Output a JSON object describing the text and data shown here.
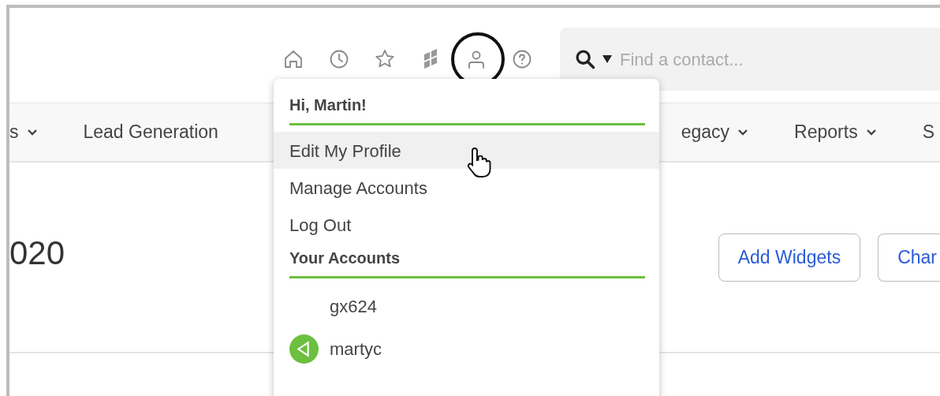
{
  "header": {
    "icons": [
      {
        "kind": "home"
      },
      {
        "kind": "clock"
      },
      {
        "kind": "star"
      },
      {
        "kind": "grid"
      },
      {
        "kind": "user",
        "highlighted": true
      },
      {
        "kind": "help"
      }
    ],
    "search": {
      "placeholder": "Find a contact..."
    }
  },
  "nav": [
    {
      "label": "s",
      "dropdown": true
    },
    {
      "label": "Lead Generation",
      "dropdown": false
    },
    {
      "label": "egacy",
      "dropdown": true
    },
    {
      "label": "Reports",
      "dropdown": true
    },
    {
      "label": "S",
      "dropdown": false
    }
  ],
  "page": {
    "heading": "020",
    "buttons": [
      "Add Widgets",
      "Char"
    ]
  },
  "user_menu": {
    "greeting": "Hi, Martin!",
    "items": [
      {
        "label": "Edit My Profile",
        "selected": true
      },
      {
        "label": "Manage Accounts",
        "selected": false
      },
      {
        "label": "Log Out",
        "selected": false
      }
    ],
    "accounts_heading": "Your Accounts",
    "accounts": [
      {
        "name": "gx624",
        "has_logo": false
      },
      {
        "name": "martyc",
        "has_logo": true
      }
    ]
  }
}
